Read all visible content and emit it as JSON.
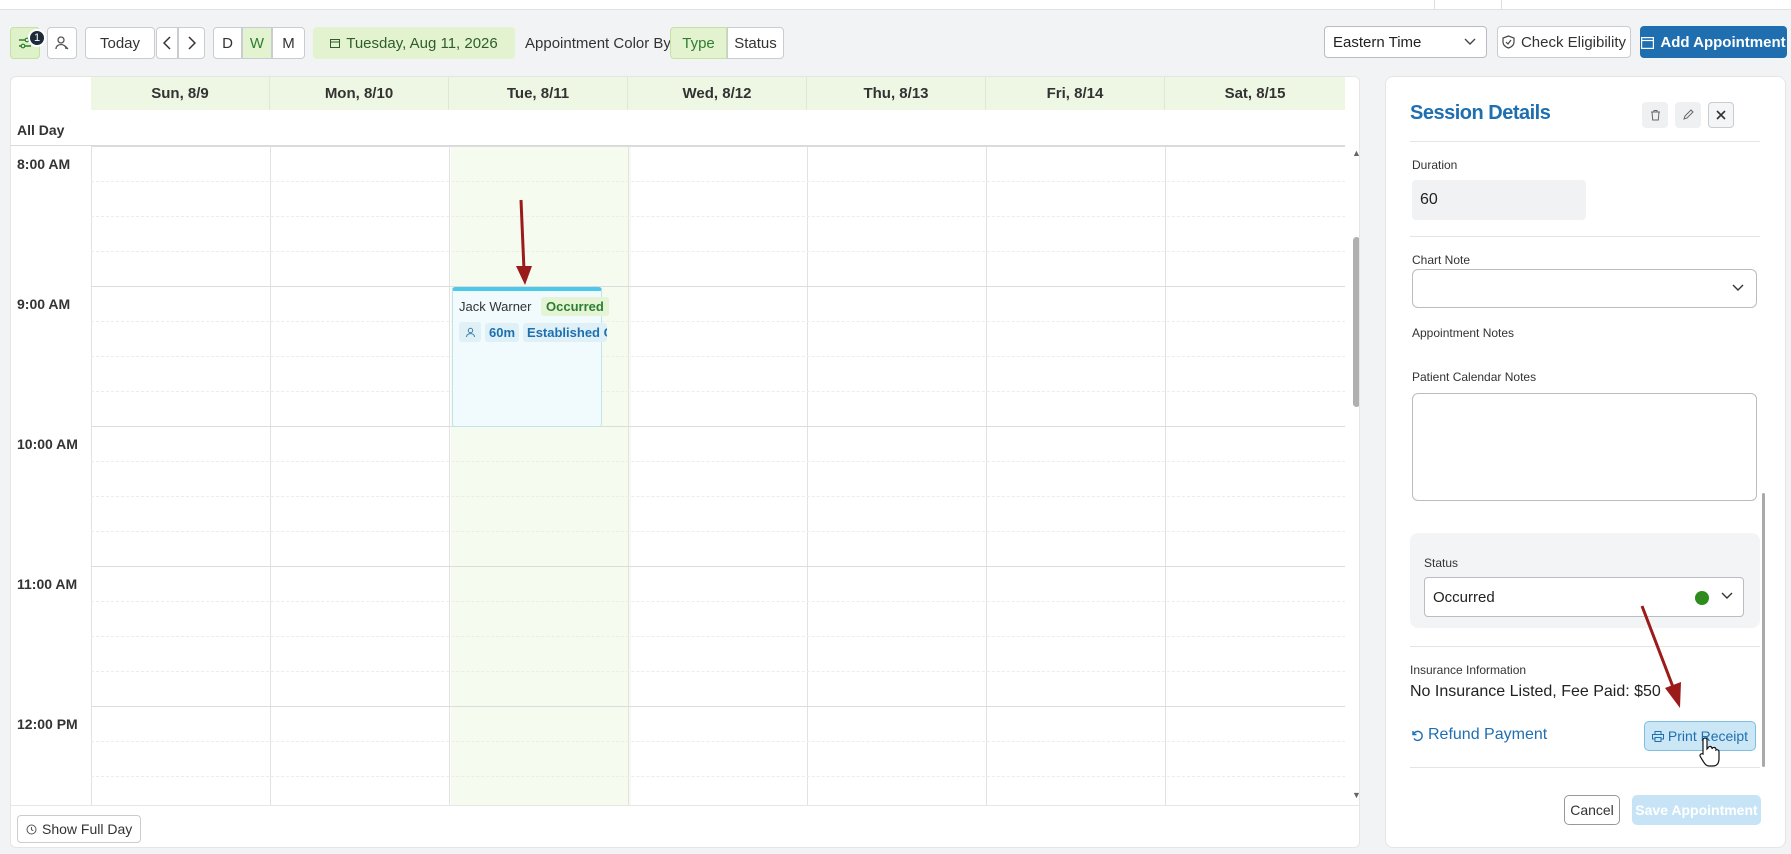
{
  "toolbar": {
    "filter_badge": "1",
    "today_label": "Today",
    "prev_label": "‹",
    "next_label": "›",
    "views": [
      "D",
      "W",
      "M"
    ],
    "selected_view": "W",
    "date_chip": "Tuesday, Aug 11, 2026",
    "color_by_label": "Appointment Color By",
    "color_by_options": [
      "Type",
      "Status"
    ],
    "color_by_selected": "Type",
    "timezone": "Eastern Time",
    "check_eligibility_label": "Check Eligibility",
    "add_appointment_label": "Add Appointment"
  },
  "calendar": {
    "days": [
      "Sun, 8/9",
      "Mon, 8/10",
      "Tue, 8/11",
      "Wed, 8/12",
      "Thu, 8/13",
      "Fri, 8/14",
      "Sat, 8/15"
    ],
    "all_day_label": "All Day",
    "times": [
      "8:00 AM",
      "9:00 AM",
      "10:00 AM",
      "11:00 AM",
      "12:00 PM"
    ],
    "show_full_day_label": "Show Full Day"
  },
  "appointment": {
    "client": "Jack Warner",
    "status": "Occurred",
    "duration": "60m",
    "type": "Established Client"
  },
  "session": {
    "title": "Session Details",
    "duration_label": "Duration",
    "duration_value": "60",
    "chart_note_label": "Chart Note",
    "appointment_notes_label": "Appointment Notes",
    "patient_calendar_notes_label": "Patient Calendar Notes",
    "status_label": "Status",
    "status_value": "Occurred",
    "insurance_label": "Insurance Information",
    "insurance_value": "No Insurance Listed, Fee Paid: $50",
    "refund_label": "Refund Payment",
    "print_receipt_label": "Print Receipt",
    "cancel_label": "Cancel",
    "save_label": "Save Appointment"
  },
  "colors": {
    "primary": "#1f6fb0",
    "accent_green": "#e3f3cf",
    "status_occurred": "#2e8b1e",
    "annotation_arrow": "#9b1b1b"
  }
}
